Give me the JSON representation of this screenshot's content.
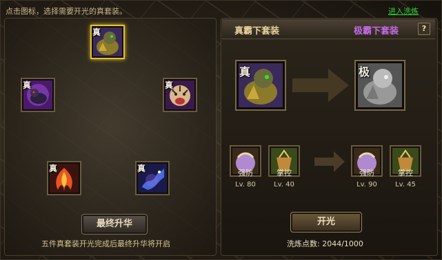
{
  "header": {
    "hint": "点击图标，选择需要开光的真套装。",
    "go_link": "进入洗炼"
  },
  "left": {
    "slot_tag": "真",
    "slots": [
      {
        "name": "qilin",
        "selected": true
      },
      {
        "name": "beast",
        "selected": false
      },
      {
        "name": "tiger",
        "selected": false
      },
      {
        "name": "phoenix",
        "selected": false
      },
      {
        "name": "dragon",
        "selected": false
      }
    ],
    "final_button": "最终升华",
    "footer_note": "五件真套装开光完成后最终升华将开启"
  },
  "right": {
    "header_left": "真霸下套装",
    "header_right": "极霸下套装",
    "help": "?",
    "current_tag": "真",
    "target_tag": "极",
    "skills_current": [
      {
        "name": "强防",
        "level": "Lv. 80"
      },
      {
        "name": "掌控",
        "level": "Lv. 40"
      }
    ],
    "skills_target": [
      {
        "name": "强防",
        "level": "Lv. 90"
      },
      {
        "name": "掌控",
        "level": "Lv. 45"
      }
    ],
    "open_button": "开光",
    "points_label": "洗炼点数:",
    "points_value": "2044/1000"
  },
  "colors": {
    "accent_gold": "#e6c22e",
    "link_green": "#2fd23a",
    "purple": "#c46ae8"
  }
}
